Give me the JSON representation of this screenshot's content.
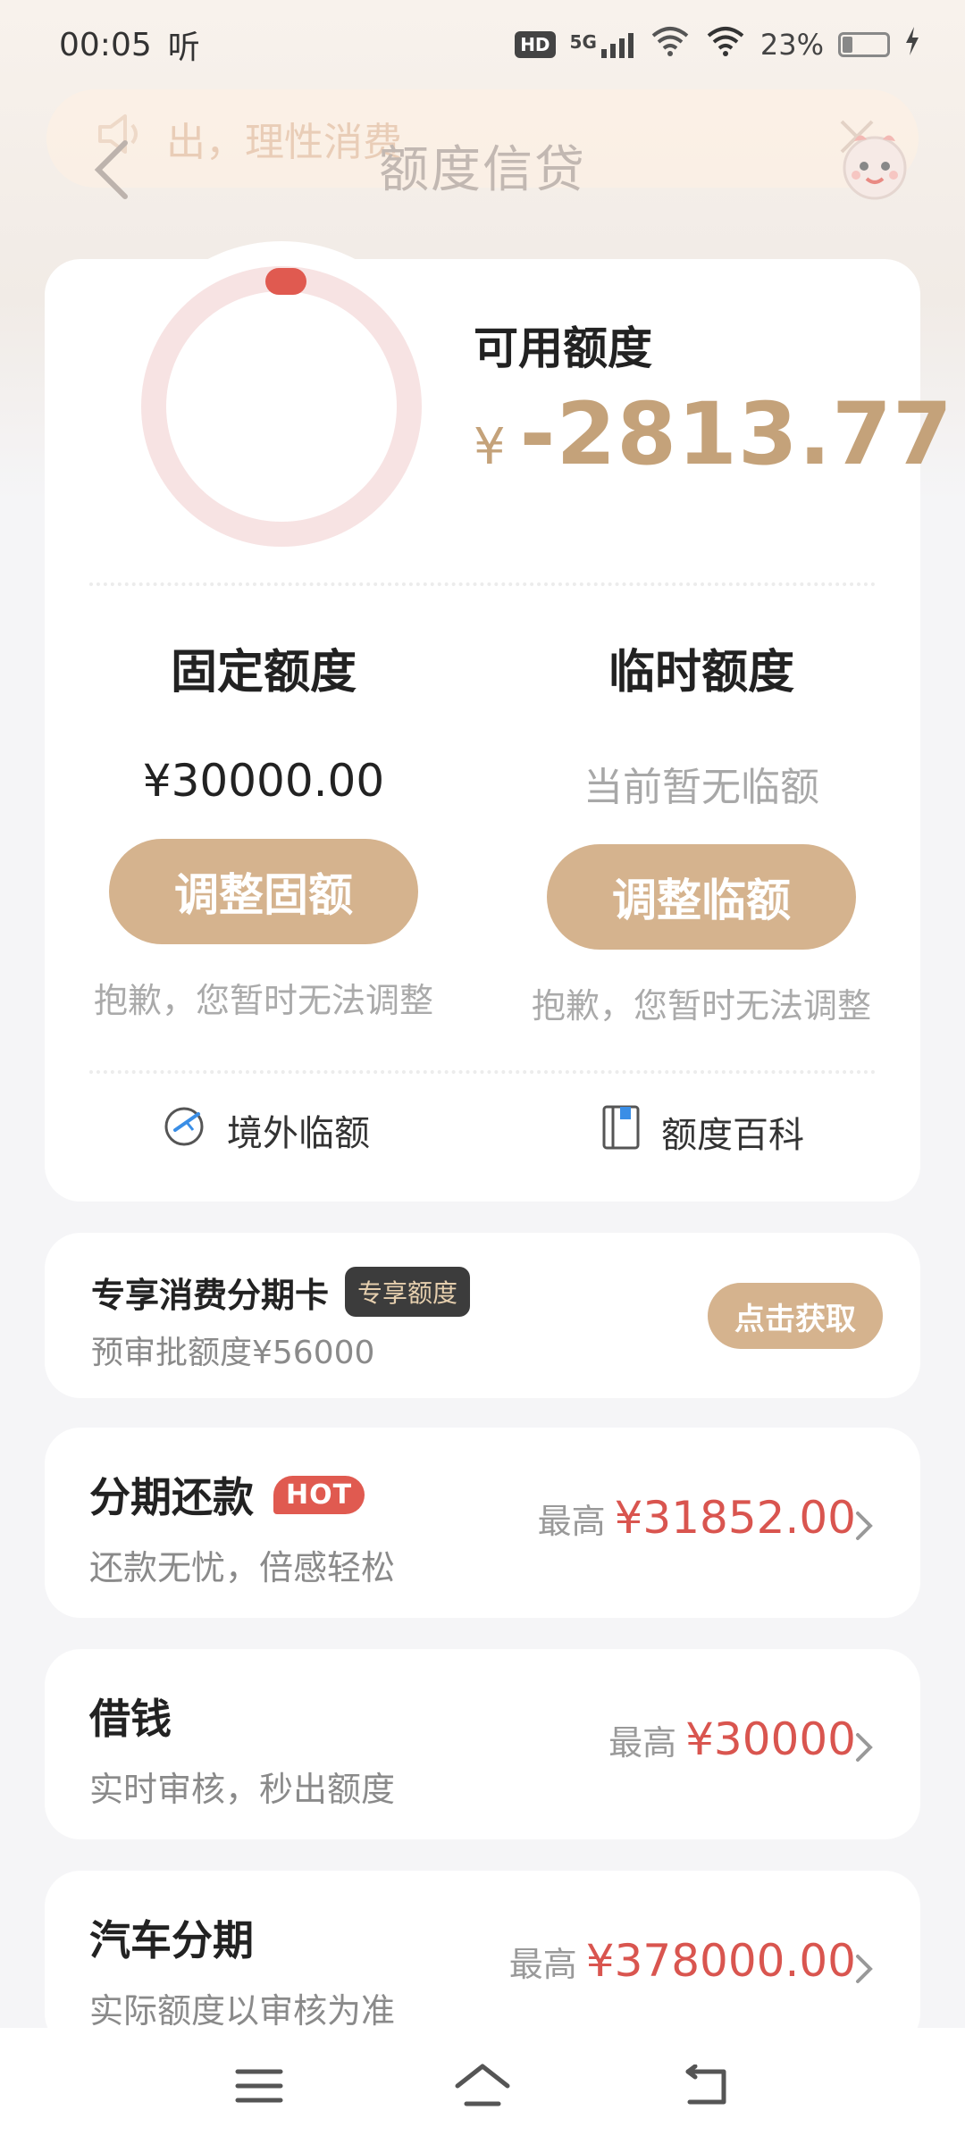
{
  "status_bar": {
    "time": "00:05",
    "carrier_text": "听",
    "hd_badge": "HD",
    "signal_label": "5G",
    "battery": "23%",
    "battery_level": 0.23
  },
  "header": {
    "marquee_text": "出，理性消费",
    "title": "额度信贷"
  },
  "available": {
    "label": "可用额度",
    "currency": "¥",
    "amount": "-2813.77"
  },
  "fixed": {
    "title": "固定额度",
    "value": "¥30000.00",
    "button": "调整固额",
    "note": "抱歉，您暂时无法调整"
  },
  "temporary": {
    "title": "临时额度",
    "value": "当前暂无临额",
    "button": "调整临额",
    "note": "抱歉，您暂时无法调整"
  },
  "quick_links": {
    "overseas": "境外临额",
    "wiki": "额度百科"
  },
  "promo": {
    "title": "专享消费分期卡",
    "tag": "专享额度",
    "subtitle": "预审批额度¥56000",
    "button": "点击获取"
  },
  "list": [
    {
      "title": "分期还款",
      "badge": "HOT",
      "subtitle": "还款无忧，倍感轻松",
      "prefix": "最高",
      "amount": "¥31852.00"
    },
    {
      "title": "借钱",
      "subtitle": "实时审核，秒出额度",
      "prefix": "最高",
      "amount": "¥30000"
    },
    {
      "title": "汽车分期",
      "subtitle": "实际额度以审核为准",
      "prefix": "最高",
      "amount": "¥378000.00"
    }
  ],
  "colors": {
    "accent_gold": "#d5b38e",
    "amount_gold": "#c4a27a",
    "price_red": "#d9554f",
    "ring_track": "#f7e3e3",
    "ring_marker": "#e05a50"
  }
}
